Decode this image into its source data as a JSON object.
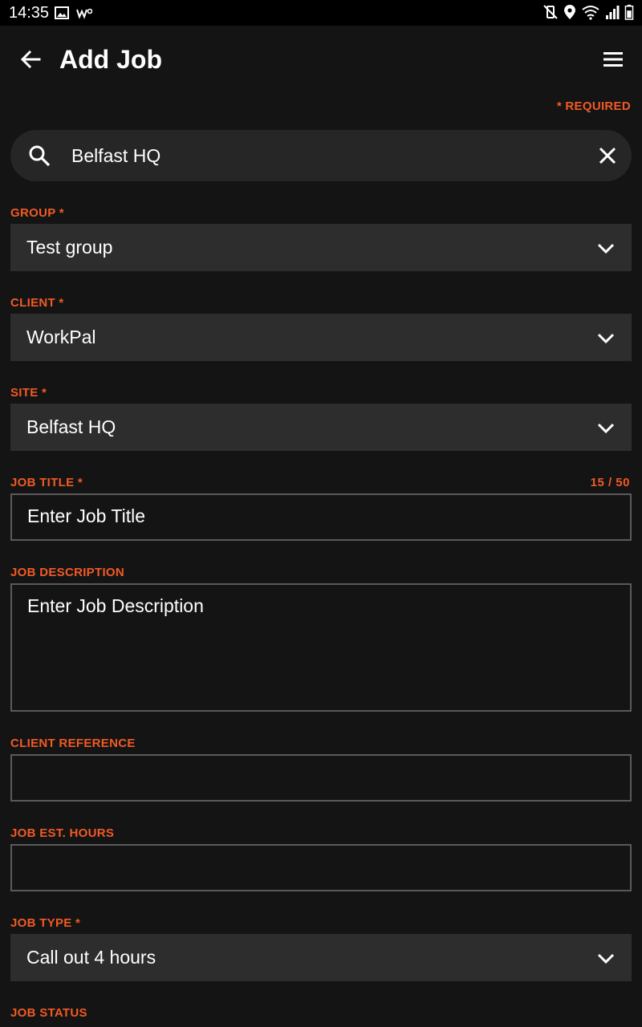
{
  "status_bar": {
    "time": "14:35",
    "left_icons": [
      "image-icon",
      "workpal-notification-icon"
    ],
    "right_icons": [
      "mute-vibrate-icon",
      "location-icon",
      "wifi-icon",
      "signal-icon",
      "battery-icon"
    ]
  },
  "header": {
    "title": "Add Job",
    "back_icon": "arrow-left-icon",
    "menu_icon": "hamburger-menu-icon"
  },
  "required_note": "* REQUIRED",
  "search": {
    "value": "Belfast HQ",
    "icon": "search-icon",
    "clear_icon": "close-icon"
  },
  "fields": {
    "group": {
      "label": "GROUP *",
      "value": "Test group"
    },
    "client": {
      "label": "CLIENT *",
      "value": "WorkPal"
    },
    "site": {
      "label": "SITE *",
      "value": "Belfast HQ"
    },
    "job_title": {
      "label": "JOB TITLE *",
      "placeholder": "Enter Job Title",
      "counter": "15 / 50"
    },
    "job_description": {
      "label": "JOB DESCRIPTION",
      "placeholder": "Enter Job Description"
    },
    "client_reference": {
      "label": "CLIENT REFERENCE",
      "value": ""
    },
    "job_est_hours": {
      "label": "JOB EST. HOURS",
      "value": ""
    },
    "job_type": {
      "label": "JOB TYPE *",
      "value": "Call out 4 hours"
    },
    "job_status": {
      "label": "JOB STATUS"
    }
  },
  "colors": {
    "accent": "#f15a24",
    "background": "#141414",
    "field_background": "#2d2d2d",
    "search_background": "#262626",
    "border": "#5a5a5a"
  }
}
